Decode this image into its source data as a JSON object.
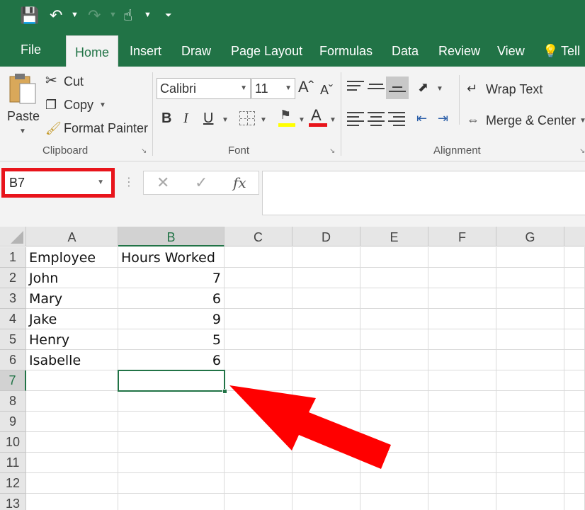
{
  "ribbon_tabs": {
    "file": "File",
    "home": "Home",
    "insert": "Insert",
    "draw": "Draw",
    "page_layout": "Page Layout",
    "formulas": "Formulas",
    "data": "Data",
    "review": "Review",
    "view": "View",
    "tell": "Tell"
  },
  "clipboard": {
    "paste": "Paste",
    "cut": "Cut",
    "copy": "Copy",
    "format_painter": "Format Painter",
    "group_label": "Clipboard"
  },
  "font": {
    "family": "Calibri",
    "size": "11",
    "group_label": "Font",
    "accent_color": "#e8141b"
  },
  "alignment": {
    "wrap_text": "Wrap Text",
    "merge_center": "Merge & Center",
    "group_label": "Alignment"
  },
  "formula_bar": {
    "name_box": "B7",
    "fx": "fx",
    "content": ""
  },
  "grid": {
    "columns": [
      "A",
      "B",
      "C",
      "D",
      "E",
      "F",
      "G"
    ],
    "selected_column": "B",
    "rows": [
      "1",
      "2",
      "3",
      "4",
      "5",
      "6",
      "7",
      "8",
      "9",
      "10",
      "11",
      "12",
      "13"
    ],
    "selected_row": "7",
    "header_row": [
      "Employee",
      "Hours Worked"
    ],
    "data": [
      [
        "John",
        "7"
      ],
      [
        "Mary",
        "6"
      ],
      [
        "Jake",
        "9"
      ],
      [
        "Henry",
        "5"
      ],
      [
        "Isabelle",
        "6"
      ]
    ]
  },
  "colors": {
    "excel_green": "#217346",
    "highlight_red": "#e8141b"
  }
}
